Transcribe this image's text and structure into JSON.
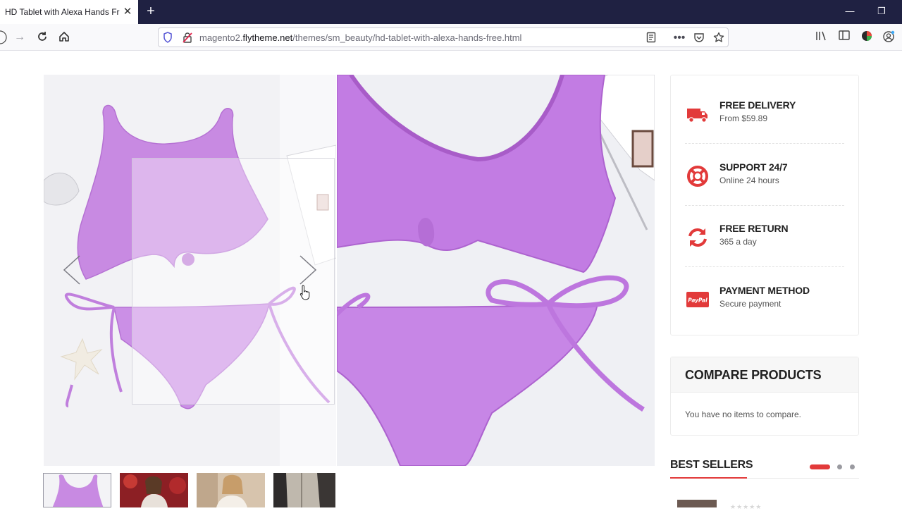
{
  "browser": {
    "tab_title": "HD Tablet with Alexa Hands Fre",
    "tab_close": "✕",
    "new_tab": "+",
    "url_prefix": "magento2.",
    "url_domain": "flytheme.net",
    "url_path": "/themes/sm_beauty/hd-tablet-with-alexa-hands-free.html"
  },
  "services": [
    {
      "title": "FREE DELIVERY",
      "subtitle": "From $59.89",
      "icon": "truck-icon"
    },
    {
      "title": "SUPPORT 24/7",
      "subtitle": "Online 24 hours",
      "icon": "lifebuoy-icon"
    },
    {
      "title": "FREE RETURN",
      "subtitle": "365 a day",
      "icon": "refresh-icon"
    },
    {
      "title": "PAYMENT METHOD",
      "subtitle": "Secure payment",
      "icon": "paypal-icon"
    }
  ],
  "paypal_label": "PayPal",
  "compare": {
    "title": "COMPARE PRODUCTS",
    "empty_text": "You have no items to compare."
  },
  "best_sellers": {
    "title": "BEST SELLERS",
    "active_slide": 1,
    "slides": 3
  },
  "colors": {
    "accent": "#e23a3a",
    "product": "#c98be6",
    "tabbar": "#1f2142"
  }
}
